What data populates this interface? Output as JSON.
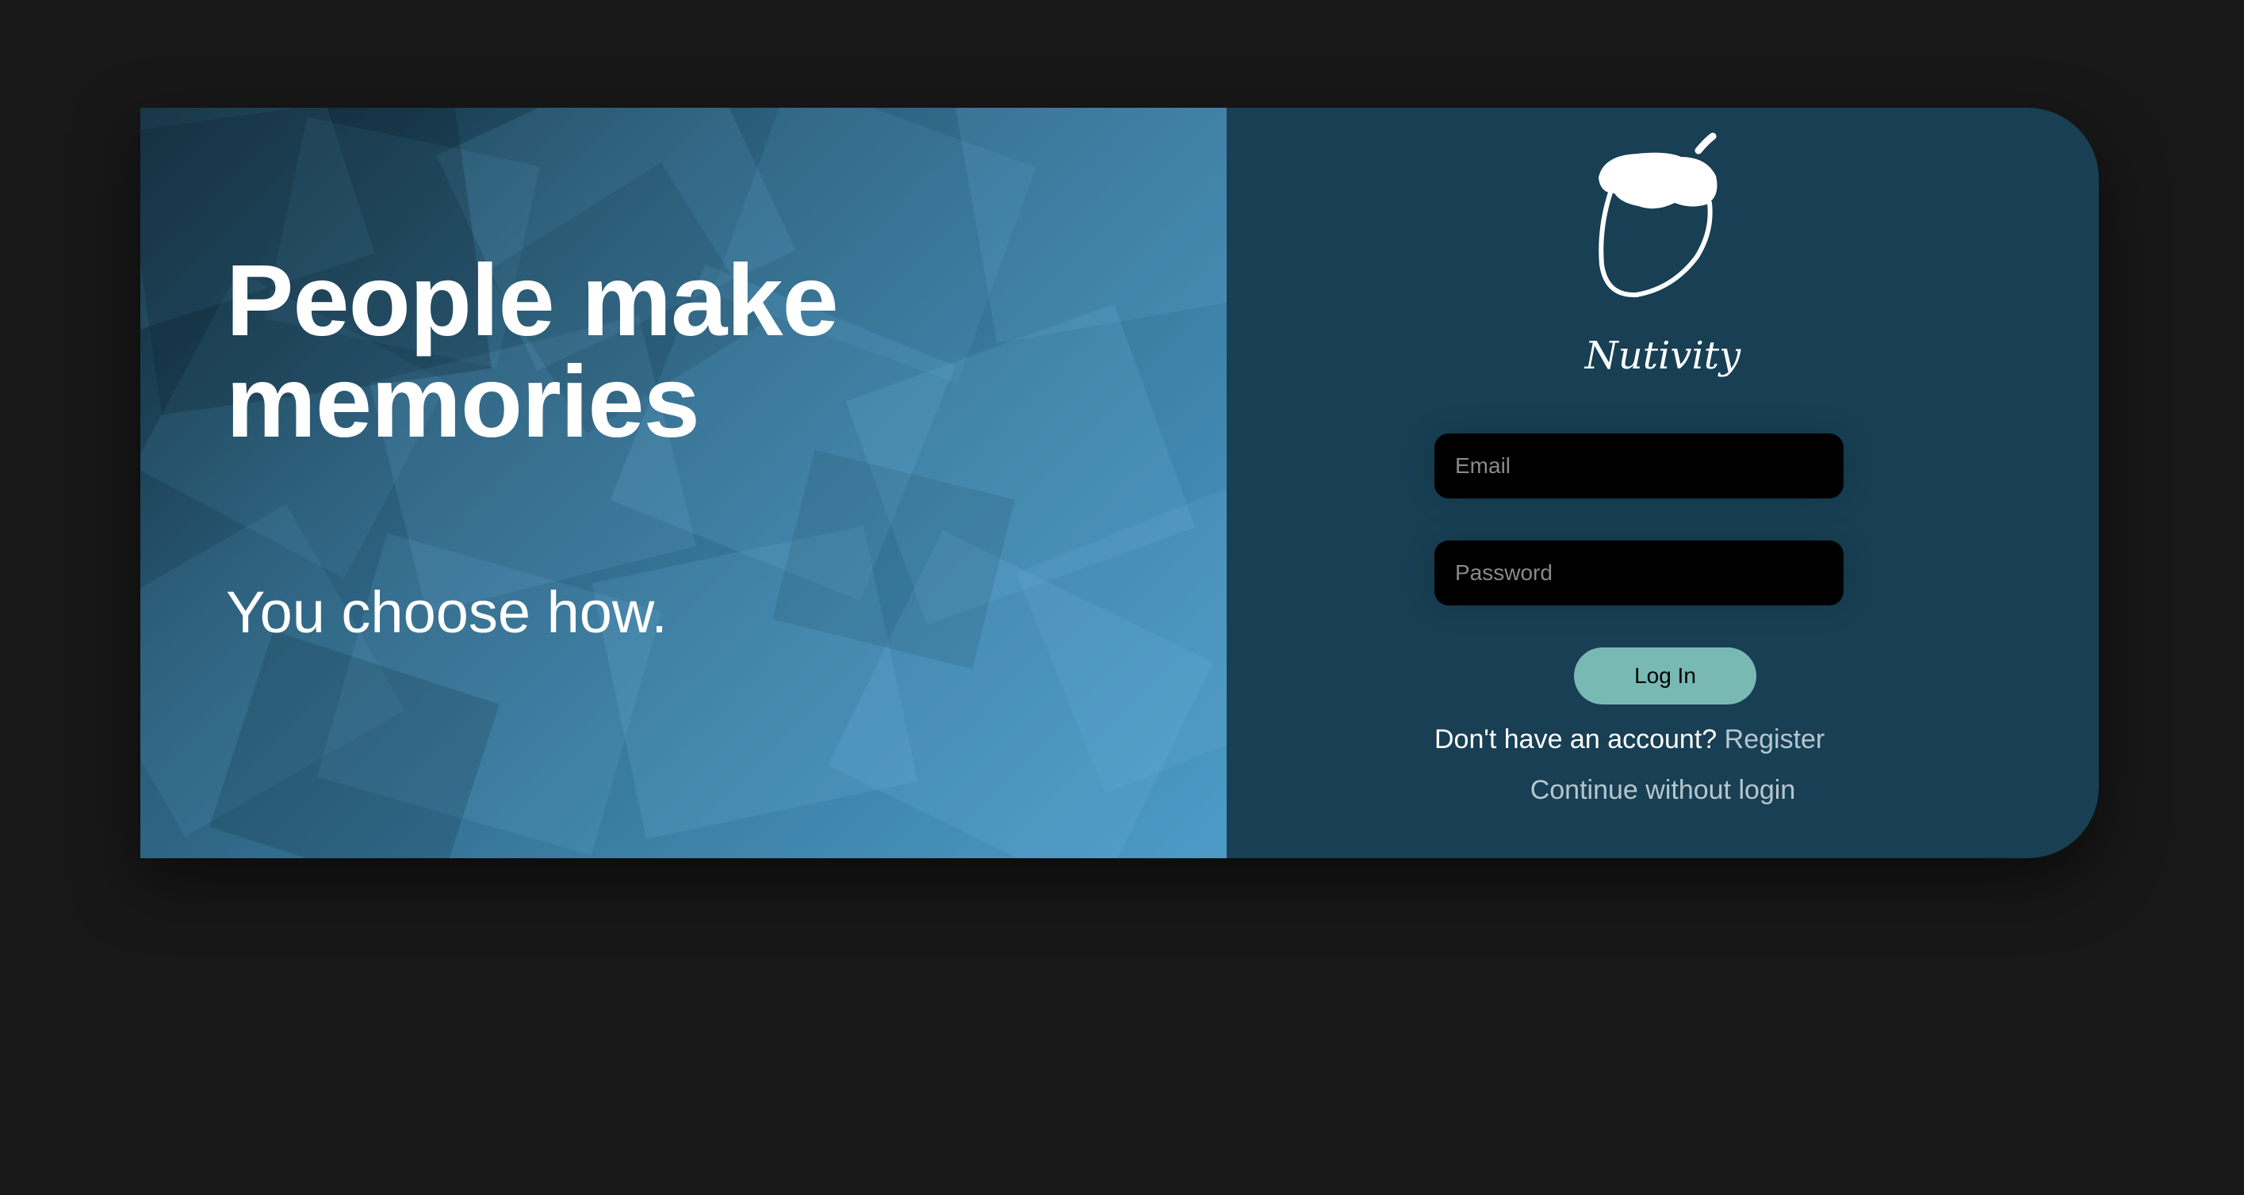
{
  "hero": {
    "headline": "People make memories",
    "subline": "You choose how."
  },
  "brand": {
    "name": "Nutivity",
    "logo_icon": "acorn-icon"
  },
  "login": {
    "email_placeholder": "Email",
    "password_placeholder": "Password",
    "submit_label": "Log In",
    "register_prompt": "Don't have an account?",
    "register_label": "Register",
    "guest_label": "Continue without login"
  },
  "colors": {
    "page_background": "#181818",
    "panel_background": "#183f53",
    "button_accent": "#78b9b4",
    "field_background": "#000000"
  }
}
